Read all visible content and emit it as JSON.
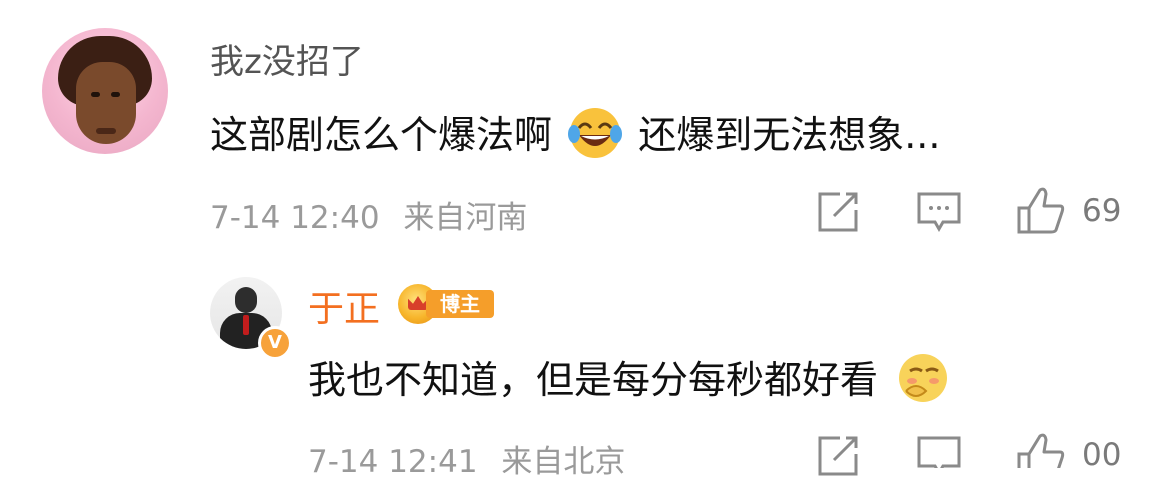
{
  "comment": {
    "username": "我z没招了",
    "text_before_emoji": "这部剧怎么个爆法啊",
    "emoji": "laughing-tears-emoji",
    "text_after_emoji": "还爆到无法想象...",
    "timestamp": "7-14 12:40",
    "location": "来自河南",
    "like_count": "69"
  },
  "reply": {
    "username": "于正",
    "badge_label": "博主",
    "verified_badge": "V",
    "text": "我也不知道，但是每分每秒都好看",
    "emoji": "blushing-shy-emoji",
    "timestamp": "7-14 12:41",
    "location": "来自北京",
    "like_count": "00"
  },
  "icons": {
    "share": "share-icon",
    "comment": "comment-icon",
    "like": "like-icon"
  },
  "colors": {
    "username_blogger": "#f36f20",
    "meta": "#9a9a9a",
    "text": "#111111",
    "badge": "#f59e2a"
  }
}
